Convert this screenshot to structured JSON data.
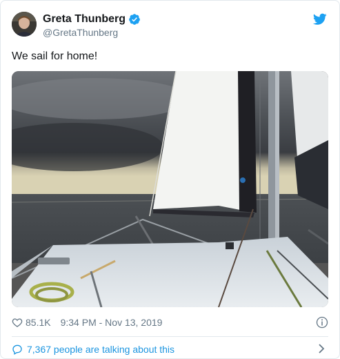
{
  "tweet": {
    "author": {
      "display_name": "Greta Thunberg",
      "handle": "@GretaThunberg",
      "verified_icon": "verified-badge-icon"
    },
    "text": "We sail for home!",
    "media": {
      "alt": "photo-sailboat-at-sea"
    },
    "likes": "85.1K",
    "timestamp": "9:34 PM - Nov 13, 2019",
    "talking_link": "7,367 people are talking about this"
  },
  "colors": {
    "twitter_blue": "#1da1f2",
    "link_blue": "#1b95e0",
    "muted_gray": "#657786",
    "divider": "#e1e8ed"
  },
  "icons": [
    "twitter-bird-icon",
    "heart-icon",
    "info-icon",
    "chat-bubble-icon",
    "chevron-right-icon",
    "verified-badge-icon"
  ]
}
